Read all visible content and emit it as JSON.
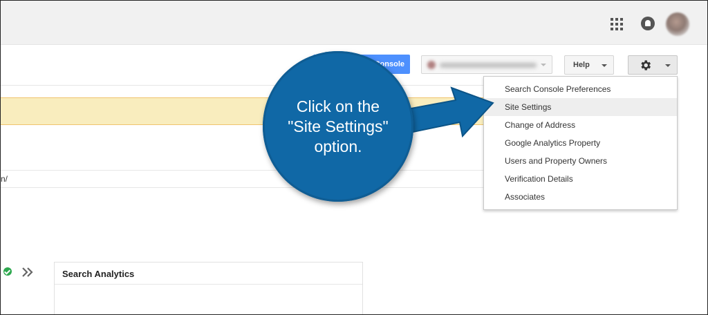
{
  "toolbar": {
    "console_button": "Console",
    "help_button": "Help"
  },
  "settings_menu": {
    "items": [
      "Search Console Preferences",
      "Site Settings",
      "Change of Address",
      "Google Analytics Property",
      "Users and Property Owners",
      "Verification Details",
      "Associates"
    ],
    "hovered_item": "Site Settings"
  },
  "callout": {
    "lines": [
      "Click on the",
      "\"Site Settings\"",
      "option."
    ],
    "color": "#1068a6"
  },
  "content": {
    "url_fragment": "n/",
    "search_analytics_title": "Search Analytics"
  },
  "icons": {
    "apps": "apps-grid-icon",
    "notifications": "bell-icon",
    "settings": "gear-icon",
    "status": "check-circle-icon",
    "expand": "double-chevron-right-icon"
  }
}
